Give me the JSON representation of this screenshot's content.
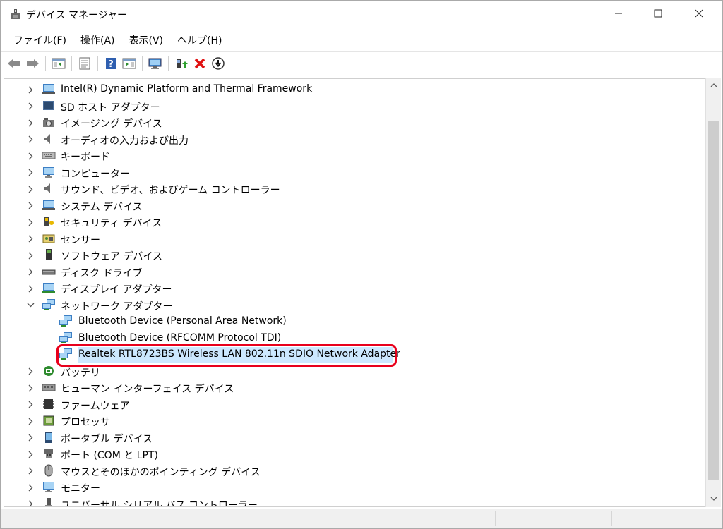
{
  "window": {
    "title": "デバイス マネージャー"
  },
  "menu": [
    "ファイル(F)",
    "操作(A)",
    "表示(V)",
    "ヘルプ(H)"
  ],
  "toolbar": {
    "buttons": [
      "back-icon",
      "forward-icon",
      "show-hide-console-tree-icon",
      "properties-icon",
      "help-icon",
      "action-pane-icon",
      "scan-hardware-icon",
      "update-driver-icon",
      "uninstall-icon",
      "disable-device-icon"
    ]
  },
  "tree": {
    "items": [
      {
        "label": "Intel(R) Dynamic Platform and Thermal Framework",
        "icon": "system-device-icon",
        "expanded": false,
        "level": 0
      },
      {
        "label": "SD ホスト アダプター",
        "icon": "sd-host-icon",
        "expanded": false,
        "level": 0
      },
      {
        "label": "イメージング デバイス",
        "icon": "camera-icon",
        "expanded": false,
        "level": 0
      },
      {
        "label": "オーディオの入力および出力",
        "icon": "speaker-icon",
        "expanded": false,
        "level": 0
      },
      {
        "label": "キーボード",
        "icon": "keyboard-icon",
        "expanded": false,
        "level": 0
      },
      {
        "label": "コンピューター",
        "icon": "computer-icon",
        "expanded": false,
        "level": 0
      },
      {
        "label": "サウンド、ビデオ、およびゲーム コントローラー",
        "icon": "sound-icon",
        "expanded": false,
        "level": 0
      },
      {
        "label": "システム デバイス",
        "icon": "system-device-icon",
        "expanded": false,
        "level": 0
      },
      {
        "label": "セキュリティ デバイス",
        "icon": "security-icon",
        "expanded": false,
        "level": 0
      },
      {
        "label": "センサー",
        "icon": "sensor-icon",
        "expanded": false,
        "level": 0
      },
      {
        "label": "ソフトウェア デバイス",
        "icon": "software-device-icon",
        "expanded": false,
        "level": 0
      },
      {
        "label": "ディスク ドライブ",
        "icon": "disk-drive-icon",
        "expanded": false,
        "level": 0
      },
      {
        "label": "ディスプレイ アダプター",
        "icon": "display-adapter-icon",
        "expanded": false,
        "level": 0
      },
      {
        "label": "ネットワーク アダプター",
        "icon": "network-adapter-icon",
        "expanded": true,
        "level": 0
      },
      {
        "label": "Bluetooth Device (Personal Area Network)",
        "icon": "network-adapter-icon",
        "level": 1
      },
      {
        "label": "Bluetooth Device (RFCOMM Protocol TDI)",
        "icon": "network-adapter-icon",
        "level": 1
      },
      {
        "label": "Realtek RTL8723BS Wireless LAN 802.11n SDIO Network Adapter",
        "icon": "network-adapter-icon",
        "level": 1,
        "selected": true
      },
      {
        "label": "バッテリ",
        "icon": "battery-icon",
        "expanded": false,
        "level": 0
      },
      {
        "label": "ヒューマン インターフェイス デバイス",
        "icon": "hid-icon",
        "expanded": false,
        "level": 0
      },
      {
        "label": "ファームウェア",
        "icon": "firmware-icon",
        "expanded": false,
        "level": 0
      },
      {
        "label": "プロセッサ",
        "icon": "processor-icon",
        "expanded": false,
        "level": 0
      },
      {
        "label": "ポータブル デバイス",
        "icon": "portable-device-icon",
        "expanded": false,
        "level": 0
      },
      {
        "label": "ポート (COM と LPT)",
        "icon": "port-icon",
        "expanded": false,
        "level": 0
      },
      {
        "label": "マウスとそのほかのポインティング デバイス",
        "icon": "mouse-icon",
        "expanded": false,
        "level": 0
      },
      {
        "label": "モニター",
        "icon": "monitor-icon",
        "expanded": false,
        "level": 0
      },
      {
        "label": "ユニバーサル シリアル バス コントローラー",
        "icon": "usb-icon",
        "expanded": false,
        "level": 0
      }
    ]
  },
  "colors": {
    "selection": "#cce8ff",
    "highlight_ring": "#e8001c"
  }
}
